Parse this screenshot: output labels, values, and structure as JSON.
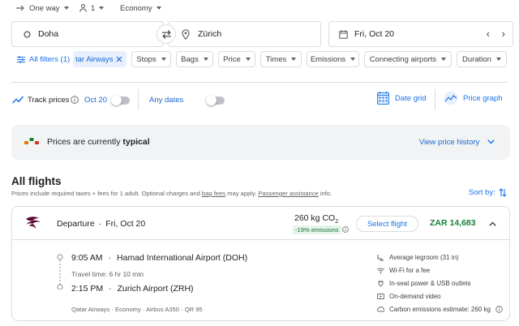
{
  "top_options": {
    "trip_type": "One way",
    "passengers": "1",
    "cabin": "Economy"
  },
  "search": {
    "origin": "Doha",
    "destination": "Zürich",
    "date": "Fri, Oct 20"
  },
  "filters": {
    "all_filters": "All filters (1)",
    "active_filter": "tar Airways",
    "chips": [
      "Stops",
      "Bags",
      "Price",
      "Times",
      "Emissions",
      "Connecting airports",
      "Duration"
    ]
  },
  "tracking": {
    "track_prices": "Track prices",
    "date": "Oct 20",
    "any_dates": "Any dates",
    "date_grid": "Date grid",
    "price_graph": "Price graph"
  },
  "price_insight": {
    "text_prefix": "Prices are currently ",
    "level": "typical",
    "link": "View price history"
  },
  "results": {
    "heading": "All flights",
    "note_prefix": "Prices include required taxes + fees for 1 adult. Optional charges and ",
    "bag_fees": "bag fees",
    "note_middle": " may apply. ",
    "passenger_assistance": "Passenger assistance",
    "note_suffix": " info.",
    "sort_label": "Sort by:"
  },
  "flight": {
    "direction": "Departure",
    "separator": "·",
    "date": "Fri, Oct 20",
    "emissions": "260 kg CO",
    "emissions_sub": "2",
    "emissions_delta": "-19% emissions",
    "select_button": "Select flight",
    "price": "ZAR 14,683",
    "depart_time": "9:05 AM",
    "depart_airport": "Hamad International Airport (DOH)",
    "travel_time": "Travel time: 6 hr 10 min",
    "arrive_time": "2:15 PM",
    "arrive_airport": "Zurich Airport (ZRH)",
    "details": "Qatar Airways · Economy · Airbus A350 · QR 95",
    "amenities": [
      {
        "icon": "legroom-icon",
        "text": "Average legroom (31 in)"
      },
      {
        "icon": "wifi-icon",
        "text": "Wi-Fi for a fee"
      },
      {
        "icon": "power-plug-icon",
        "text": "In-seat power & USB outlets"
      },
      {
        "icon": "video-icon",
        "text": "On-demand video"
      },
      {
        "icon": "co2-icon",
        "text": "Carbon emissions estimate: 260 kg"
      }
    ]
  },
  "colors": {
    "accent": "#1a73e8",
    "price_green": "#188038",
    "chip_active_bg": "#e8f0fe",
    "insight_bg": "#f1f3f4",
    "emissions_bg": "#e6f4ea",
    "airline_maroon": "#5c0632"
  }
}
